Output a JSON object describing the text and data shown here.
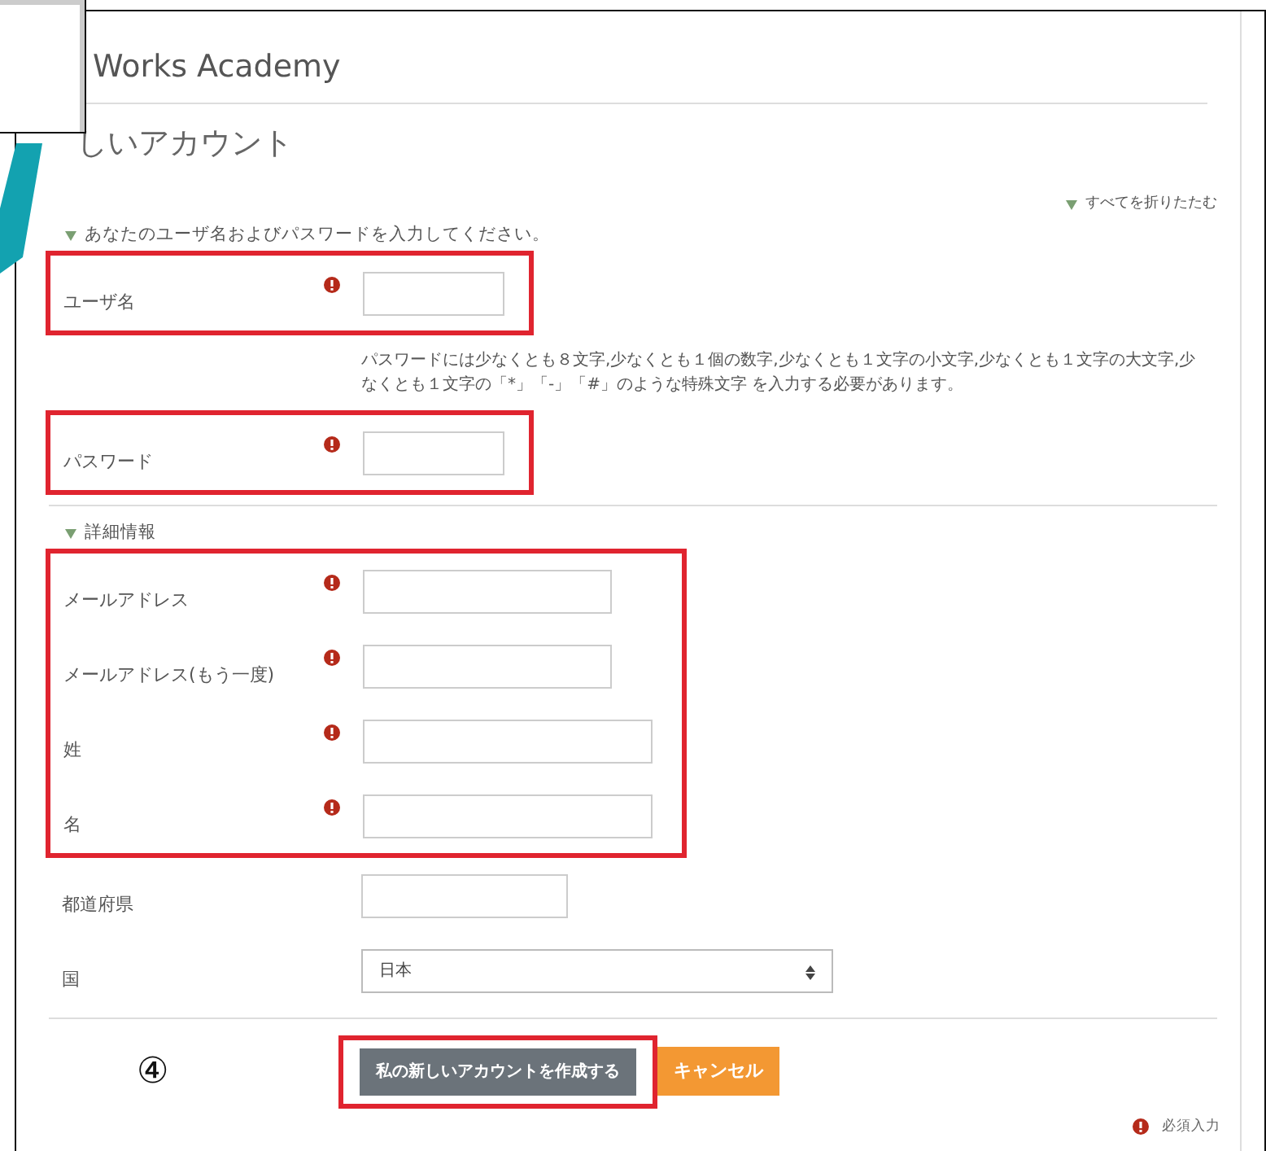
{
  "site_name": "Works Academy",
  "page_title": "しいアカウント",
  "collapse_all": "すべてを折りたたむ",
  "sections": [
    {
      "legend": "あなたのユーザ名およびパスワードを入力してください。",
      "expanded": true,
      "groups": [
        {
          "highlighted": true,
          "fields": [
            {
              "label": "ユーザ名",
              "required": true,
              "kind": "short"
            }
          ]
        },
        {
          "highlighted": false,
          "fields": [
            {
              "kind": "help",
              "text": "パスワードには少なくとも８文字,少なくとも１個の数字,少なくとも１文字の小文字,少なくとも１文字の大文字,少なくとも１文字の「*」「-」「#」のような特殊文字 を入力する必要があります。"
            }
          ]
        },
        {
          "highlighted": true,
          "fields": [
            {
              "label": "パスワード",
              "required": true,
              "kind": "short"
            }
          ]
        }
      ]
    },
    {
      "legend": "詳細情報",
      "expanded": true,
      "groups": [
        {
          "highlighted": true,
          "fields": [
            {
              "label": "メールアドレス",
              "required": true,
              "kind": "medium"
            },
            {
              "label": "メールアドレス(もう一度)",
              "required": true,
              "kind": "medium"
            },
            {
              "label": "姓",
              "required": true,
              "kind": "long"
            },
            {
              "label": "名",
              "required": true,
              "kind": "long"
            }
          ]
        },
        {
          "highlighted": false,
          "fields": [
            {
              "label": "都道府県",
              "required": false,
              "kind": "middle"
            },
            {
              "label": "国",
              "required": false,
              "kind": "select",
              "value": "日本"
            }
          ]
        }
      ]
    }
  ],
  "step_marker": "④",
  "buttons": [
    {
      "label": "私の新しいアカウントを作成する",
      "kind": "submit",
      "highlighted": true
    },
    {
      "label": "キャンセル",
      "kind": "cancel",
      "highlighted": false
    }
  ],
  "required_note": "必須入力"
}
